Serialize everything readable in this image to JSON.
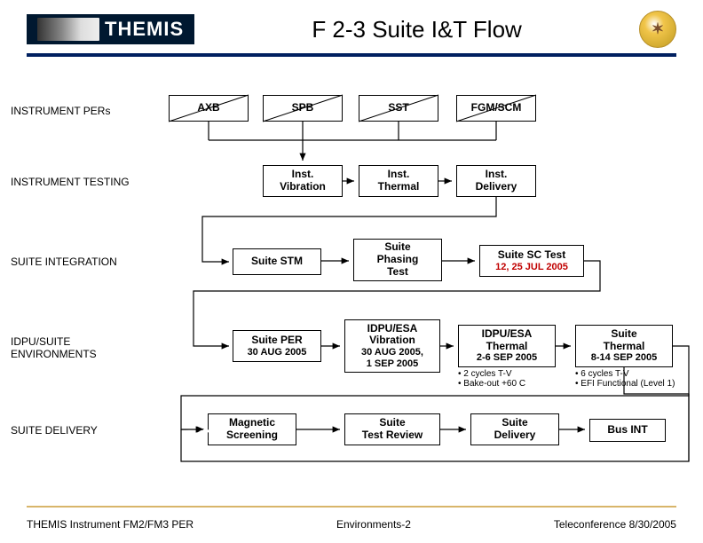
{
  "header": {
    "logo_text": "THEMIS",
    "title": "F 2-3 Suite I&T Flow"
  },
  "rows": {
    "r1": "INSTRUMENT PERs",
    "r2": "INSTRUMENT TESTING",
    "r3": "SUITE INTEGRATION",
    "r4": "IDPU/SUITE\nENVIRONMENTS",
    "r5": "SUITE DELIVERY"
  },
  "boxes": {
    "axb": "AXB",
    "spb": "SPB",
    "sst": "SST",
    "fgmscm": "FGM/SCM",
    "inst_vib": "Inst.\nVibration",
    "inst_therm": "Inst.\nThermal",
    "inst_deliv": "Inst.\nDelivery",
    "suite_stm": "Suite STM",
    "suite_phasing": "Suite\nPhasing\nTest",
    "suite_sc_test_main": "Suite SC Test",
    "suite_sc_test_sub": "12, 25 JUL 2005",
    "suite_per_main": "Suite PER",
    "suite_per_sub": "30 AUG 2005",
    "idpu_esa_vib_main": "IDPU/ESA\nVibration",
    "idpu_esa_vib_sub": "30 AUG 2005,\n1 SEP 2005",
    "idpu_esa_therm_main": "IDPU/ESA\nThermal",
    "idpu_esa_therm_sub": "2-6 SEP 2005",
    "idpu_esa_therm_note": "• 2 cycles T-V\n• Bake-out +60 C",
    "suite_therm_main": "Suite\nThermal",
    "suite_therm_sub": "8-14 SEP 2005",
    "suite_therm_note": "• 6 cycles T-V\n• EFI Functional (Level 1)",
    "mag_screen": "Magnetic\nScreening",
    "suite_test_rev": "Suite\nTest Review",
    "suite_deliv": "Suite\nDelivery",
    "bus_int": "Bus INT"
  },
  "footer": {
    "left": "THEMIS Instrument FM2/FM3 PER",
    "center": "Environments-2",
    "right": "Teleconference 8/30/2005"
  }
}
